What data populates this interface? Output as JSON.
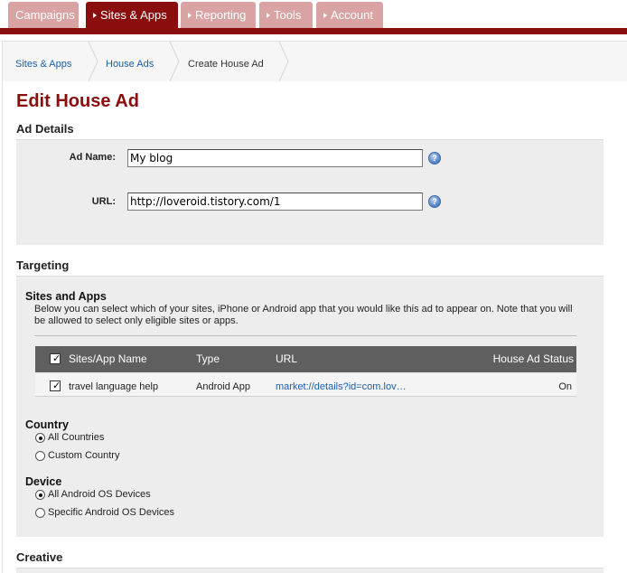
{
  "nav": {
    "tabs": [
      {
        "label": "Campaigns",
        "active": false,
        "has_arrow": false
      },
      {
        "label": "Sites & Apps",
        "active": true,
        "has_arrow": true
      },
      {
        "label": "Reporting",
        "active": false,
        "has_arrow": true
      },
      {
        "label": "Tools",
        "active": false,
        "has_arrow": true
      },
      {
        "label": "Account",
        "active": false,
        "has_arrow": true
      }
    ]
  },
  "breadcrumb": {
    "items": [
      "Sites & Apps",
      "House Ads",
      "Create House Ad"
    ]
  },
  "page": {
    "title": "Edit House Ad"
  },
  "ad_details": {
    "heading": "Ad Details",
    "ad_name_label": "Ad Name:",
    "ad_name_value": "My blog",
    "url_label": "URL:",
    "url_value": "http://loveroid.tistory.com/1",
    "help_glyph": "?"
  },
  "targeting": {
    "heading": "Targeting",
    "sites_apps": {
      "heading": "Sites and Apps",
      "description": "Below you can select which of your sites, iPhone or Android app that you would like this ad to appear on. Note that you will be allowed to select only eligible sites or apps.",
      "columns": [
        "Sites/App Name",
        "Type",
        "URL",
        "House Ad Status"
      ],
      "header_checked": true,
      "rows": [
        {
          "checked": true,
          "name": "travel language help",
          "type": "Android App",
          "url": "market://details?id=com.lov…",
          "status": "On"
        }
      ]
    },
    "country": {
      "heading": "Country",
      "options": [
        {
          "label": "All Countries",
          "selected": true
        },
        {
          "label": "Custom Country",
          "selected": false
        }
      ]
    },
    "device": {
      "heading": "Device",
      "options": [
        {
          "label": "All Android OS Devices",
          "selected": true
        },
        {
          "label": "Specific Android OS Devices",
          "selected": false
        }
      ]
    }
  },
  "creative": {
    "heading": "Creative"
  },
  "colors": {
    "brand_red": "#8b0e0e",
    "tab_inactive": "#d9a3a3",
    "link_blue": "#1a5ea8",
    "panel_gray": "#ededed",
    "table_header": "#5f5f5f"
  },
  "glyphs": {
    "check": "✓"
  }
}
